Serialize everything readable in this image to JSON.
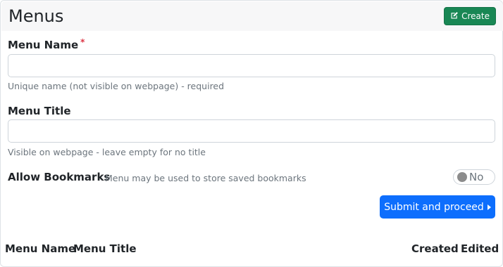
{
  "header": {
    "title": "Menus",
    "create_label": "Create"
  },
  "form": {
    "menu_name": {
      "label": "Menu Name",
      "required_mark": "*",
      "value": "",
      "help": "Unique name (not visible on webpage) - required"
    },
    "menu_title": {
      "label": "Menu Title",
      "value": "",
      "help": "Visible on webpage - leave empty for no title"
    },
    "bookmarks": {
      "label": "Allow Bookmarks",
      "description": "Menu may be used to store saved bookmarks",
      "toggle_text": "No",
      "enabled": false
    },
    "submit_label": "Submit and proceed"
  },
  "table": {
    "columns": [
      "Menu Name",
      "Menu Title",
      "Created",
      "Edited"
    ]
  },
  "colors": {
    "primary": "#0d6efd",
    "success": "#198754",
    "required": "#dc3545"
  }
}
